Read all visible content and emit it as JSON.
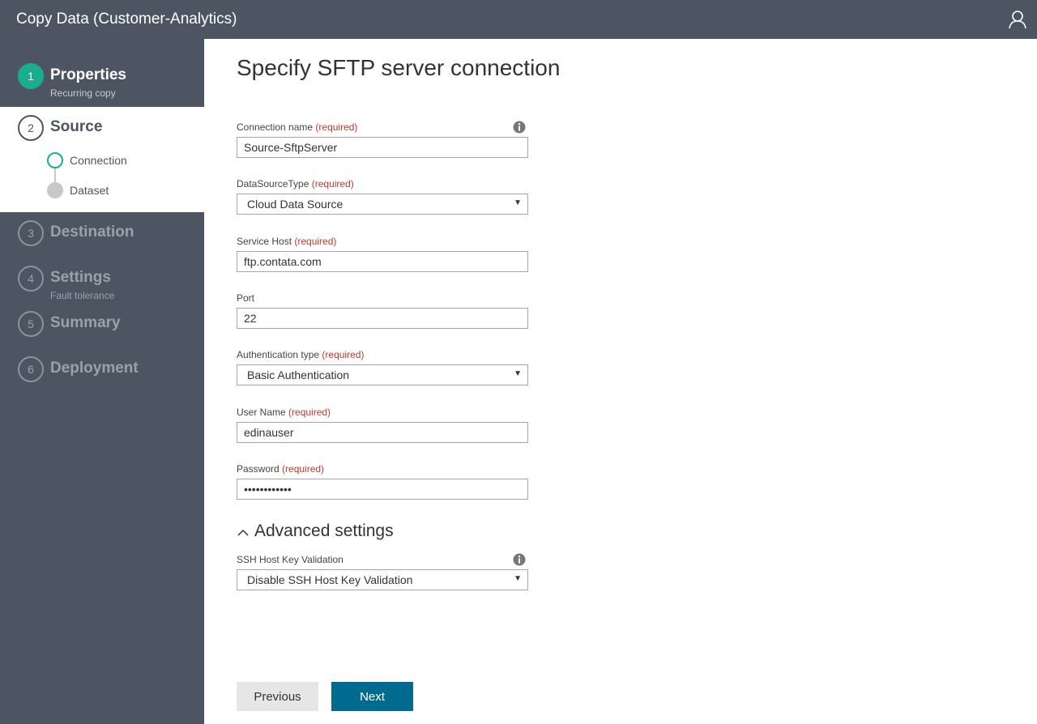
{
  "header": {
    "title": "Copy Data (Customer-Analytics)"
  },
  "sidebar": {
    "steps": [
      {
        "number": "1",
        "name": "Properties",
        "sub": "Recurring copy",
        "state": "done"
      },
      {
        "number": "2",
        "name": "Source",
        "sub": "",
        "state": "active"
      },
      {
        "number": "3",
        "name": "Destination",
        "sub": "",
        "state": "pending"
      },
      {
        "number": "4",
        "name": "Settings",
        "sub": "Fault tolerance",
        "state": "pending"
      },
      {
        "number": "5",
        "name": "Summary",
        "sub": "",
        "state": "pending"
      },
      {
        "number": "6",
        "name": "Deployment",
        "sub": "",
        "state": "pending"
      }
    ],
    "substeps": [
      {
        "label": "Connection",
        "state": "current"
      },
      {
        "label": "Dataset",
        "state": "pending"
      }
    ]
  },
  "form": {
    "title": "Specify SFTP server connection",
    "required_text": "(required)",
    "connection_name": {
      "label": "Connection name",
      "value": "Source-SftpServer"
    },
    "data_source_type": {
      "label": "DataSourceType",
      "value": "Cloud Data Source"
    },
    "service_host": {
      "label": "Service Host",
      "value": "ftp.contata.com"
    },
    "port": {
      "label": "Port",
      "value": "22"
    },
    "auth_type": {
      "label": "Authentication type",
      "value": "Basic Authentication"
    },
    "user_name": {
      "label": "User Name",
      "value": "edinauser"
    },
    "password": {
      "label": "Password",
      "value": "••••••••••••"
    },
    "advanced": {
      "title": "Advanced settings",
      "ssh_label": "SSH Host Key Validation",
      "ssh_value": "Disable SSH Host Key Validation"
    }
  },
  "buttons": {
    "previous": "Previous",
    "next": "Next"
  },
  "colors": {
    "sidebar": "#4c5561",
    "accent_green": "#1aaf8c",
    "primary_button": "#006b8f",
    "required": "#c0392b"
  },
  "icons": {
    "user": "user-icon",
    "info": "info-icon",
    "collapse": "chevron-up-icon",
    "dropdown": "dropdown-arrow-icon"
  }
}
